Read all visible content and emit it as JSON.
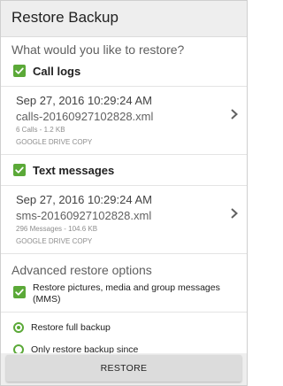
{
  "window": {
    "title": "Restore Backup"
  },
  "question": "What would you like to restore?",
  "sections": [
    {
      "label": "Call logs",
      "checked": true,
      "file": {
        "date": "Sep 27, 2016 10:29:24 AM",
        "filename": "calls-20160927102828.xml",
        "meta": "6 Calls - 1.2 KB",
        "source": "GOOGLE DRIVE COPY"
      }
    },
    {
      "label": "Text messages",
      "checked": true,
      "file": {
        "date": "Sep 27, 2016 10:29:24 AM",
        "filename": "sms-20160927102828.xml",
        "meta": "296 Messages - 104.6 KB",
        "source": "GOOGLE DRIVE COPY"
      }
    }
  ],
  "advanced": {
    "title": "Advanced restore options",
    "option_media": {
      "label": "Restore pictures, media and group messages (MMS)",
      "checked": true
    },
    "radio_full": {
      "label": "Restore full backup",
      "selected": true
    },
    "radio_since": {
      "label": "Only restore backup since",
      "selected": false
    }
  },
  "restore_button": "RESTORE",
  "colors": {
    "accent": "#5ba938",
    "titlebar": "#eeeeee",
    "button": "#dcdcdc"
  }
}
